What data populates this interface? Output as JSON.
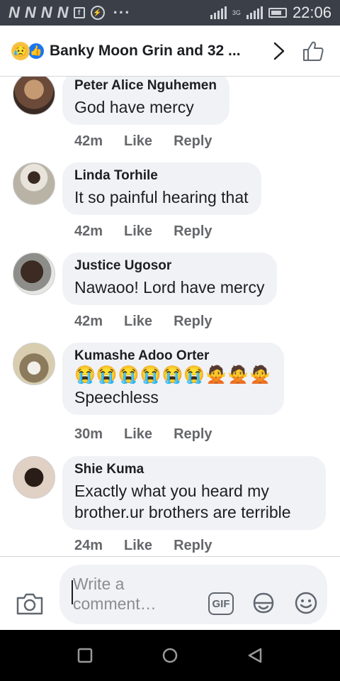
{
  "status_bar": {
    "n_icons": [
      "N",
      "N",
      "N",
      "N"
    ],
    "box_icon": "f",
    "net_label": "3G",
    "time": "22:06"
  },
  "header": {
    "title": "Banky Moon Grin and 32 ...",
    "reactions": [
      "sad-reaction-icon",
      "like-reaction-icon"
    ]
  },
  "comments": [
    {
      "name": "Peter Alice Nguhemen",
      "text": "God have mercy",
      "time": "42m",
      "like": "Like",
      "reply": "Reply",
      "avatar_color": "#6b4a3a"
    },
    {
      "name": "Linda Torhile",
      "text": "It so painful hearing that",
      "time": "42m",
      "like": "Like",
      "reply": "Reply",
      "avatar_color": "#b9b3a6"
    },
    {
      "name": "Justice Ugosor",
      "text": "Nawaoo! Lord have mercy",
      "time": "42m",
      "like": "Like",
      "reply": "Reply",
      "avatar_color": "#4a3a30"
    },
    {
      "name": "Kumashe Adoo Orter",
      "emojis": "😭😭😭😭😭😭🙅🙅🙅",
      "text": "Speechless",
      "time": "30m",
      "like": "Like",
      "reply": "Reply",
      "avatar_color": "#c8b99a"
    },
    {
      "name": "Shie Kuma",
      "text": "Exactly what you heard my brother.ur brothers are terrible",
      "time": "24m",
      "like": "Like",
      "reply": "Reply",
      "avatar_color": "#d8c3b4"
    }
  ],
  "composer": {
    "placeholder": "Write a comment…",
    "gif_label": "GIF"
  },
  "colors": {
    "bubble": "#f0f2f5",
    "meta_text": "#65676b",
    "status_bar": "#3b3f47",
    "accent": "#1877f2"
  }
}
